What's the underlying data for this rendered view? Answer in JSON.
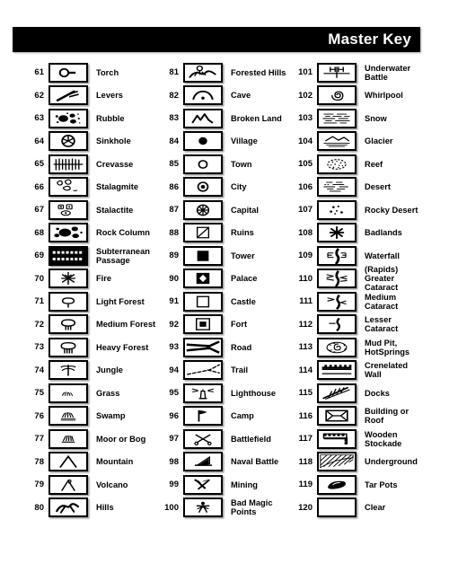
{
  "header": {
    "title": "Master Key"
  },
  "columns": [
    {
      "name": "column-1",
      "entries": [
        {
          "num": "61",
          "label": "Torch",
          "icon": "torch-icon"
        },
        {
          "num": "62",
          "label": "Levers",
          "icon": "levers-icon"
        },
        {
          "num": "63",
          "label": "Rubble",
          "icon": "rubble-icon"
        },
        {
          "num": "64",
          "label": "Sinkhole",
          "icon": "sinkhole-icon"
        },
        {
          "num": "65",
          "label": "Crevasse",
          "icon": "crevasse-icon"
        },
        {
          "num": "66",
          "label": "Stalagmite",
          "icon": "stalagmite-icon"
        },
        {
          "num": "67",
          "label": "Stalactite",
          "icon": "stalactite-icon"
        },
        {
          "num": "68",
          "label": "Rock Column",
          "icon": "rock-column-icon"
        },
        {
          "num": "69",
          "label": "Subterranean",
          "label2": "Passage",
          "icon": "subterranean-passage-icon"
        },
        {
          "num": "70",
          "label": "Fire",
          "icon": "fire-icon"
        },
        {
          "num": "71",
          "label": "Light Forest",
          "icon": "light-forest-icon"
        },
        {
          "num": "72",
          "label": "Medium Forest",
          "icon": "medium-forest-icon"
        },
        {
          "num": "73",
          "label": "Heavy Forest",
          "icon": "heavy-forest-icon"
        },
        {
          "num": "74",
          "label": "Jungle",
          "icon": "jungle-icon"
        },
        {
          "num": "75",
          "label": "Grass",
          "icon": "grass-icon"
        },
        {
          "num": "76",
          "label": "Swamp",
          "icon": "swamp-icon"
        },
        {
          "num": "77",
          "label": "Moor or Bog",
          "icon": "moor-or-bog-icon"
        },
        {
          "num": "78",
          "label": "Mountain",
          "icon": "mountain-icon"
        },
        {
          "num": "79",
          "label": "Volcano",
          "icon": "volcano-icon"
        },
        {
          "num": "80",
          "label": "Hills",
          "icon": "hills-icon"
        }
      ]
    },
    {
      "name": "column-2",
      "entries": [
        {
          "num": "81",
          "label": "Forested Hills",
          "icon": "forested-hills-icon"
        },
        {
          "num": "82",
          "label": "Cave",
          "icon": "cave-icon"
        },
        {
          "num": "83",
          "label": "Broken Land",
          "icon": "broken-land-icon"
        },
        {
          "num": "84",
          "label": "Village",
          "icon": "village-icon"
        },
        {
          "num": "85",
          "label": "Town",
          "icon": "town-icon"
        },
        {
          "num": "86",
          "label": "City",
          "icon": "city-icon"
        },
        {
          "num": "87",
          "label": "Capital",
          "icon": "capital-icon"
        },
        {
          "num": "88",
          "label": "Ruins",
          "icon": "ruins-icon"
        },
        {
          "num": "89",
          "label": "Tower",
          "icon": "tower-icon"
        },
        {
          "num": "90",
          "label": "Palace",
          "icon": "palace-icon"
        },
        {
          "num": "91",
          "label": "Castle",
          "icon": "castle-icon"
        },
        {
          "num": "92",
          "label": "Fort",
          "icon": "fort-icon"
        },
        {
          "num": "93",
          "label": "Road",
          "icon": "road-icon"
        },
        {
          "num": "94",
          "label": "Trail",
          "icon": "trail-icon"
        },
        {
          "num": "95",
          "label": "Lighthouse",
          "icon": "lighthouse-icon"
        },
        {
          "num": "96",
          "label": "Camp",
          "icon": "camp-icon"
        },
        {
          "num": "97",
          "label": "Battlefield",
          "icon": "battlefield-icon"
        },
        {
          "num": "98",
          "label": "Naval Battle",
          "icon": "naval-battle-icon"
        },
        {
          "num": "99",
          "label": "Mining",
          "icon": "mining-icon"
        },
        {
          "num": "100",
          "label": "Bad Magic Points",
          "icon": "bad-magic-points-icon"
        }
      ]
    },
    {
      "name": "column-3",
      "entries": [
        {
          "num": "101",
          "label": "Underwater",
          "label2": "Battle",
          "icon": "underwater-battle-icon"
        },
        {
          "num": "102",
          "label": "Whirlpool",
          "icon": "whirlpool-icon"
        },
        {
          "num": "103",
          "label": "Snow",
          "icon": "snow-icon"
        },
        {
          "num": "104",
          "label": "Glacier",
          "icon": "glacier-icon"
        },
        {
          "num": "105",
          "label": "Reef",
          "icon": "reef-icon"
        },
        {
          "num": "106",
          "label": "Desert",
          "icon": "desert-icon"
        },
        {
          "num": "107",
          "label": "Rocky Desert",
          "icon": "rocky-desert-icon"
        },
        {
          "num": "108",
          "label": "Badlands",
          "icon": "badlands-icon"
        },
        {
          "num": "109",
          "label": "Waterfall",
          "icon": "waterfall-icon"
        },
        {
          "num": "110",
          "label": "(Rapids)",
          "label2": "Greater",
          "label3": "Cataract",
          "icon": "greater-cataract-icon"
        },
        {
          "num": "111",
          "label": "Medium",
          "label2": "Cataract",
          "icon": "medium-cataract-icon"
        },
        {
          "num": "112",
          "label": "Lesser",
          "label2": "Cataract",
          "icon": "lesser-cataract-icon"
        },
        {
          "num": "113",
          "label": "Mud Pit,",
          "label2": "HotSprings",
          "icon": "mud-pit-hot-springs-icon"
        },
        {
          "num": "114",
          "label": "Crenelated",
          "label2": "Wall",
          "icon": "crenelated-wall-icon"
        },
        {
          "num": "115",
          "label": "Docks",
          "icon": "docks-icon"
        },
        {
          "num": "116",
          "label": "Building or",
          "label2": "Roof",
          "icon": "building-or-roof-icon"
        },
        {
          "num": "117",
          "label": "Wooden",
          "label2": "Stockade",
          "icon": "wooden-stockade-icon"
        },
        {
          "num": "118",
          "label": "Underground",
          "icon": "underground-icon"
        },
        {
          "num": "119",
          "label": "Tar Pots",
          "icon": "tar-pots-icon"
        },
        {
          "num": "120",
          "label": "Clear",
          "icon": "clear-icon"
        }
      ]
    }
  ],
  "colors": {
    "ink": "#000000",
    "paper": "#ffffff",
    "header_bg": "#000000",
    "header_text": "#ffffff"
  }
}
